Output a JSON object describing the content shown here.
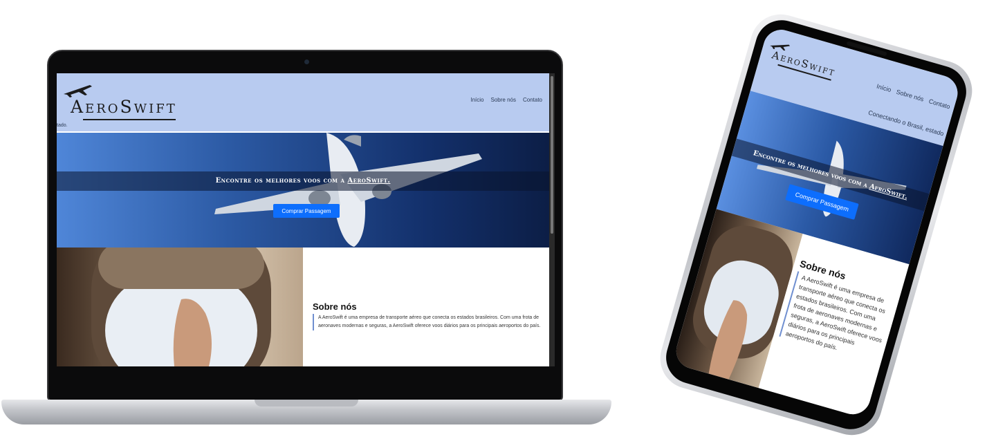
{
  "brand": {
    "name": "AeroSwift"
  },
  "nav": {
    "items": [
      "Início",
      "Sobre nós",
      "Contato"
    ]
  },
  "header": {
    "slogan_desktop": "tado.",
    "slogan_mobile": "Conectando o Brasil, estado"
  },
  "hero": {
    "title_prefix": "Encontre os melhores voos com a",
    "title_brand": "AeroSwift.",
    "button_label": "Comprar Passagem"
  },
  "about": {
    "title": "Sobre nós",
    "body": "A AeroSwift é uma empresa de transporte aéreo que conecta os estados brasileiros. Com uma frota de aeronaves modernas e seguras, a AeroSwift oferece voos diários para os principais aeroportos do país."
  },
  "colors": {
    "header_bg": "#b8cbf0",
    "hero_light": "#4f86d8",
    "hero_dark": "#0c1e46",
    "button": "#0d6efd",
    "accent_line": "#6f8fd0"
  },
  "icons": {
    "logo": "airplane-icon"
  }
}
